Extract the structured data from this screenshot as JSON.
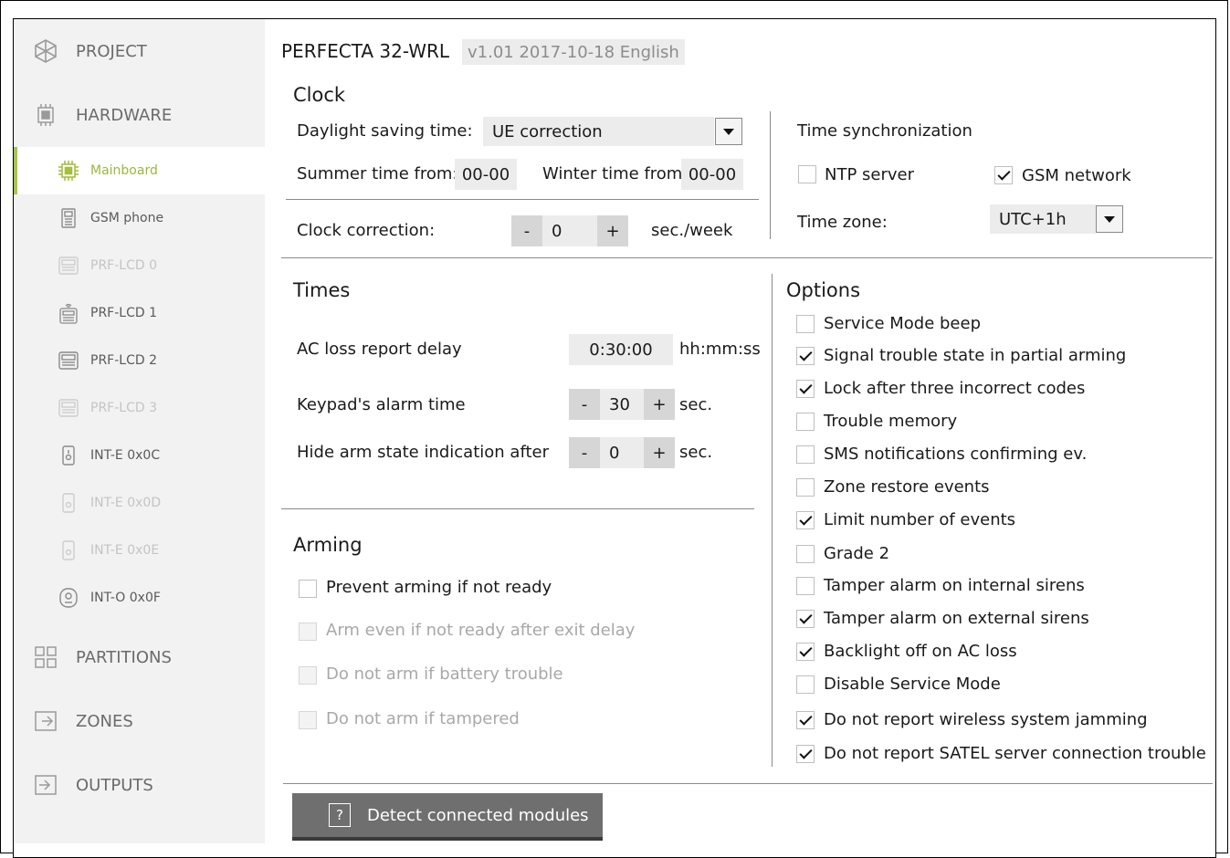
{
  "header": {
    "device": "PERFECTA 32-WRL",
    "version": "v1.01 2017-10-18 English"
  },
  "sidebar": {
    "top_items": [
      {
        "label": "PROJECT",
        "icon": "project-icon"
      },
      {
        "label": "HARDWARE",
        "icon": "hardware-icon"
      },
      {
        "label": "PARTITIONS",
        "icon": "partitions-icon"
      },
      {
        "label": "ZONES",
        "icon": "zones-icon"
      },
      {
        "label": "OUTPUTS",
        "icon": "outputs-icon"
      }
    ],
    "hardware_items": [
      {
        "label": "Mainboard",
        "icon": "mainboard-chip-icon",
        "state": "active"
      },
      {
        "label": "GSM phone",
        "icon": "gsm-phone-icon",
        "state": "normal"
      },
      {
        "label": "PRF-LCD 0",
        "icon": "keypad-icon",
        "state": "dim"
      },
      {
        "label": "PRF-LCD 1",
        "icon": "wireless-keypad-icon",
        "state": "normal"
      },
      {
        "label": "PRF-LCD 2",
        "icon": "keypad-icon",
        "state": "normal"
      },
      {
        "label": "PRF-LCD 3",
        "icon": "keypad-icon",
        "state": "dim"
      },
      {
        "label": "INT-E 0x0C",
        "icon": "expander-icon",
        "state": "normal"
      },
      {
        "label": "INT-E 0x0D",
        "icon": "expander-icon",
        "state": "dim"
      },
      {
        "label": "INT-E 0x0E",
        "icon": "expander-icon",
        "state": "dim"
      },
      {
        "label": "INT-O 0x0F",
        "icon": "output-module-icon",
        "state": "normal"
      }
    ]
  },
  "clock": {
    "title": "Clock",
    "dst_label": "Daylight saving time:",
    "dst_value": "UE correction",
    "summer_label": "Summer time from:",
    "summer_value": "00-00",
    "winter_label": "Winter time from:",
    "winter_value": "00-00",
    "correction_label": "Clock correction:",
    "correction_value": "0",
    "correction_unit": "sec./week",
    "sync_title": "Time synchronization",
    "ntp_label": "NTP server",
    "ntp_checked": false,
    "gsm_label": "GSM network",
    "gsm_checked": true,
    "tz_label": "Time zone:",
    "tz_value": "UTC+1h"
  },
  "times": {
    "title": "Times",
    "ac_label": "AC loss report delay",
    "ac_value": "0:30:00",
    "ac_unit": "hh:mm:ss",
    "keypad_label": "Keypad's alarm time",
    "keypad_value": "30",
    "keypad_unit": "sec.",
    "hide_label": "Hide arm state indication after",
    "hide_value": "0",
    "hide_unit": "sec."
  },
  "arming": {
    "title": "Arming",
    "items": [
      {
        "label": "Prevent arming if not ready",
        "checked": false,
        "disabled": false
      },
      {
        "label": "Arm even if not ready after exit delay",
        "checked": false,
        "disabled": true
      },
      {
        "label": "Do not arm if battery trouble",
        "checked": false,
        "disabled": true
      },
      {
        "label": "Do not arm if tampered",
        "checked": false,
        "disabled": true
      }
    ]
  },
  "options": {
    "title": "Options",
    "items": [
      {
        "label": "Service Mode beep",
        "checked": false
      },
      {
        "label": "Signal trouble state in partial arming",
        "checked": true
      },
      {
        "label": "Lock after three incorrect codes",
        "checked": true
      },
      {
        "label": "Trouble memory",
        "checked": false
      },
      {
        "label": "SMS notifications confirming ev.",
        "checked": false
      },
      {
        "label": "Zone restore events",
        "checked": false
      },
      {
        "label": "Limit number of events",
        "checked": true
      },
      {
        "label": "Grade 2",
        "checked": false
      },
      {
        "label": "Tamper alarm on internal sirens",
        "checked": false
      },
      {
        "label": "Tamper alarm on external sirens",
        "checked": true
      },
      {
        "label": "Backlight off on AC loss",
        "checked": true
      },
      {
        "label": "Disable Service Mode",
        "checked": false
      },
      {
        "label": "Do not report wireless system jamming",
        "checked": true
      },
      {
        "label": "Do not report SATEL server connection trouble",
        "checked": true
      }
    ]
  },
  "actions": {
    "detect_label": "Detect connected modules"
  },
  "symbols": {
    "minus": "-",
    "plus": "+",
    "help_glyph": "?"
  }
}
